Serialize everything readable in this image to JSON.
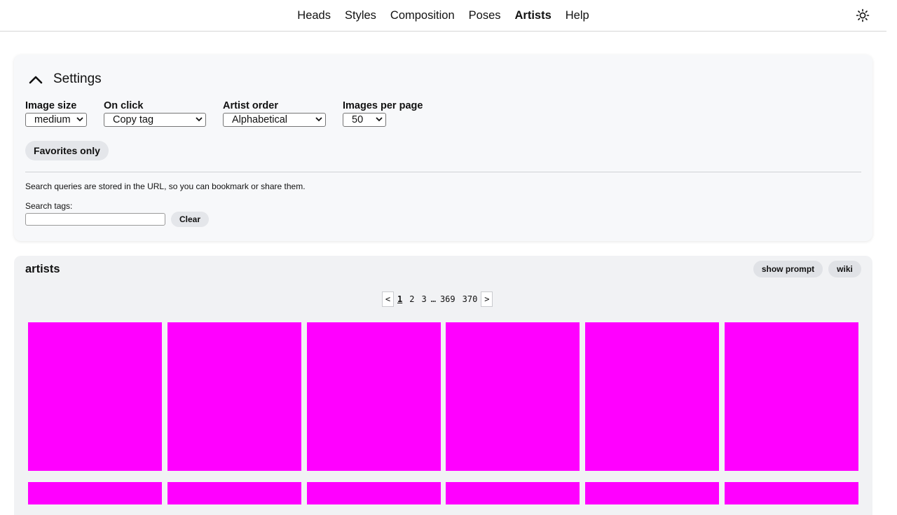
{
  "nav": {
    "items": [
      "Heads",
      "Styles",
      "Composition",
      "Poses",
      "Artists",
      "Help"
    ],
    "active": "Artists"
  },
  "settings": {
    "title": "Settings",
    "fields": {
      "image_size": {
        "label": "Image size",
        "value": "medium"
      },
      "on_click": {
        "label": "On click",
        "value": "Copy tag"
      },
      "artist_order": {
        "label": "Artist order",
        "value": "Alphabetical"
      },
      "images_per_page": {
        "label": "Images per page",
        "value": "50"
      }
    },
    "favorites_label": "Favorites only",
    "note": "Search queries are stored in the URL, so you can bookmark or share them.",
    "search_label": "Search tags:",
    "search_value": "",
    "clear_label": "Clear"
  },
  "artists": {
    "heading": "artists",
    "show_prompt_label": "show prompt",
    "wiki_label": "wiki",
    "pagination": {
      "prev": "<",
      "next": ">",
      "pages": [
        "1",
        "2",
        "3",
        "…",
        "369",
        "370"
      ],
      "current": "1"
    },
    "tile_color": "#ff00ff"
  },
  "colors": {
    "accent_tile": "#ff00ff",
    "panel_bg": "#f7f8fa",
    "pill_bg": "#e4e6ea"
  },
  "icons": {
    "theme_toggle": "sun-icon",
    "settings_toggle": "chevron-up-icon"
  }
}
